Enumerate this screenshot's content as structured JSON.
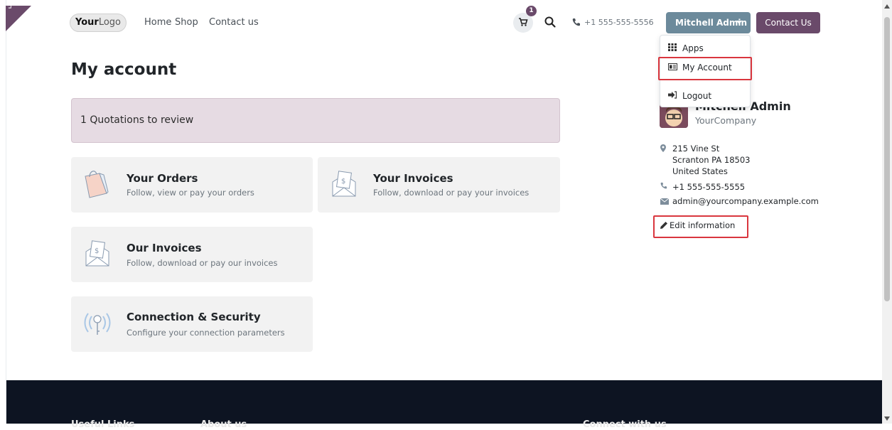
{
  "header": {
    "logo_text_bold": "Your",
    "logo_text_rest": "Logo",
    "nav": [
      "Home",
      "Shop",
      "Contact us"
    ],
    "cart_count": "1",
    "phone": "+1 555-555-5556",
    "user_menu_label": "Mitchell Admin",
    "contact_button": "Contact Us",
    "icons": {
      "cart": "cart-icon",
      "search": "search-icon",
      "phone": "phone-icon"
    }
  },
  "user_dropdown": {
    "items": [
      {
        "label": "Apps",
        "icon": "grid-icon"
      },
      {
        "label": "My Account",
        "icon": "id-card-icon",
        "highlighted": true
      },
      {
        "label": "Logout",
        "icon": "logout-icon"
      }
    ]
  },
  "main": {
    "title": "My account",
    "alert": "1 Quotations to review",
    "cards": [
      {
        "title": "Your Orders",
        "subtitle": "Follow, view or pay your orders",
        "icon": "shopping-bag-icon"
      },
      {
        "title": "Your Invoices",
        "subtitle": "Follow, download or pay your invoices",
        "icon": "invoice-envelope-icon"
      },
      {
        "title": "Our Invoices",
        "subtitle": "Follow, download or pay our invoices",
        "icon": "invoice-envelope-icon"
      },
      {
        "title": "Connection & Security",
        "subtitle": "Configure your connection parameters",
        "icon": "signal-key-icon"
      }
    ]
  },
  "sidebar": {
    "name": "Mitchell Admin",
    "company": "YourCompany",
    "address": [
      "215 Vine St",
      "Scranton PA 18503",
      "United States"
    ],
    "phone": "+1 555-555-5555",
    "email": "admin@yourcompany.example.com",
    "edit_label": "Edit information"
  },
  "footer": {
    "headings": [
      "Useful Links",
      "About us",
      "Connect with us"
    ]
  },
  "colors": {
    "brand": "#6a4a6a",
    "user_button": "#6c8a9b",
    "alert_bg": "#e6dbe3",
    "card_bg": "#f2f2f2",
    "footer_bg": "#0d1422",
    "highlight": "#d9363e"
  }
}
